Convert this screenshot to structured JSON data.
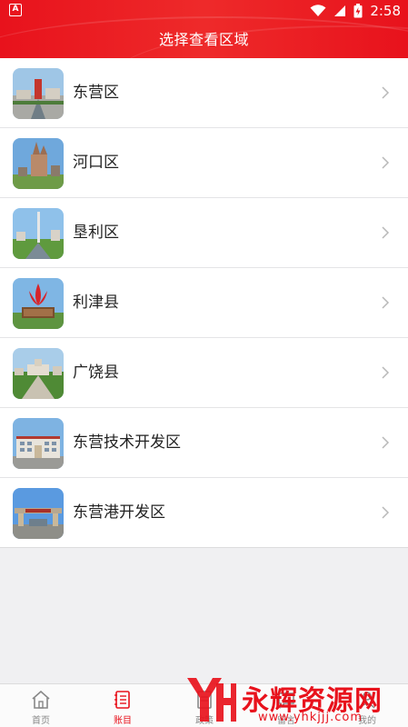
{
  "status_bar": {
    "time": "2:58",
    "left_badge": "A"
  },
  "header": {
    "title": "选择查看区域"
  },
  "regions": [
    {
      "label": "东营区"
    },
    {
      "label": "河口区"
    },
    {
      "label": "垦利区"
    },
    {
      "label": "利津县"
    },
    {
      "label": "广饶县"
    },
    {
      "label": "东营技术开发区"
    },
    {
      "label": "东营港开发区"
    }
  ],
  "bottom_nav": {
    "tabs": [
      {
        "label": "首页",
        "icon": "home-icon"
      },
      {
        "label": "账目",
        "icon": "ledger-icon"
      },
      {
        "label": "政策",
        "icon": "policy-icon"
      },
      {
        "label": "留言",
        "icon": "message-icon"
      },
      {
        "label": "我的",
        "icon": "user-icon"
      }
    ],
    "active_index": 1
  },
  "watermark": {
    "brand": "永辉资源网",
    "url": "www.yhkjjj.com"
  },
  "colors": {
    "accent": "#e8121c",
    "background": "#f0f0f2"
  }
}
